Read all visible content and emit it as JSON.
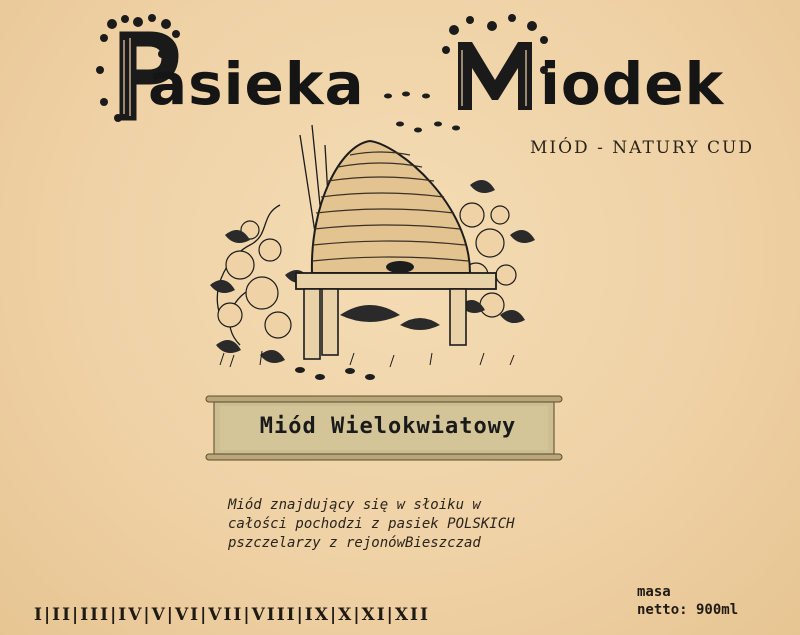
{
  "brand": {
    "title_word_1": "asieka",
    "title_word_2": "iodek",
    "initial_1": "P",
    "initial_2": "M",
    "tagline": "MIÓD - NATURY CUD"
  },
  "product": {
    "name": "Miód Wielokwiatowy"
  },
  "description": {
    "lines": [
      "Miód znajdujący się w słoiku w",
      "całości pochodzi z pasiek POLSKICH",
      "pszczelarzy z rejonówBieszczad"
    ]
  },
  "months": "I|II|III|IV|V|VI|VII|VIII|IX|X|XI|XII",
  "mass": {
    "label": "masa",
    "value": "netto: 900ml"
  },
  "colors": {
    "paper": "#efd2a6",
    "ink": "#151515",
    "scroll": "#c9b98f"
  },
  "icons": [
    "beehive-illustration",
    "bee-icon",
    "flower-icon",
    "scroll-banner"
  ]
}
